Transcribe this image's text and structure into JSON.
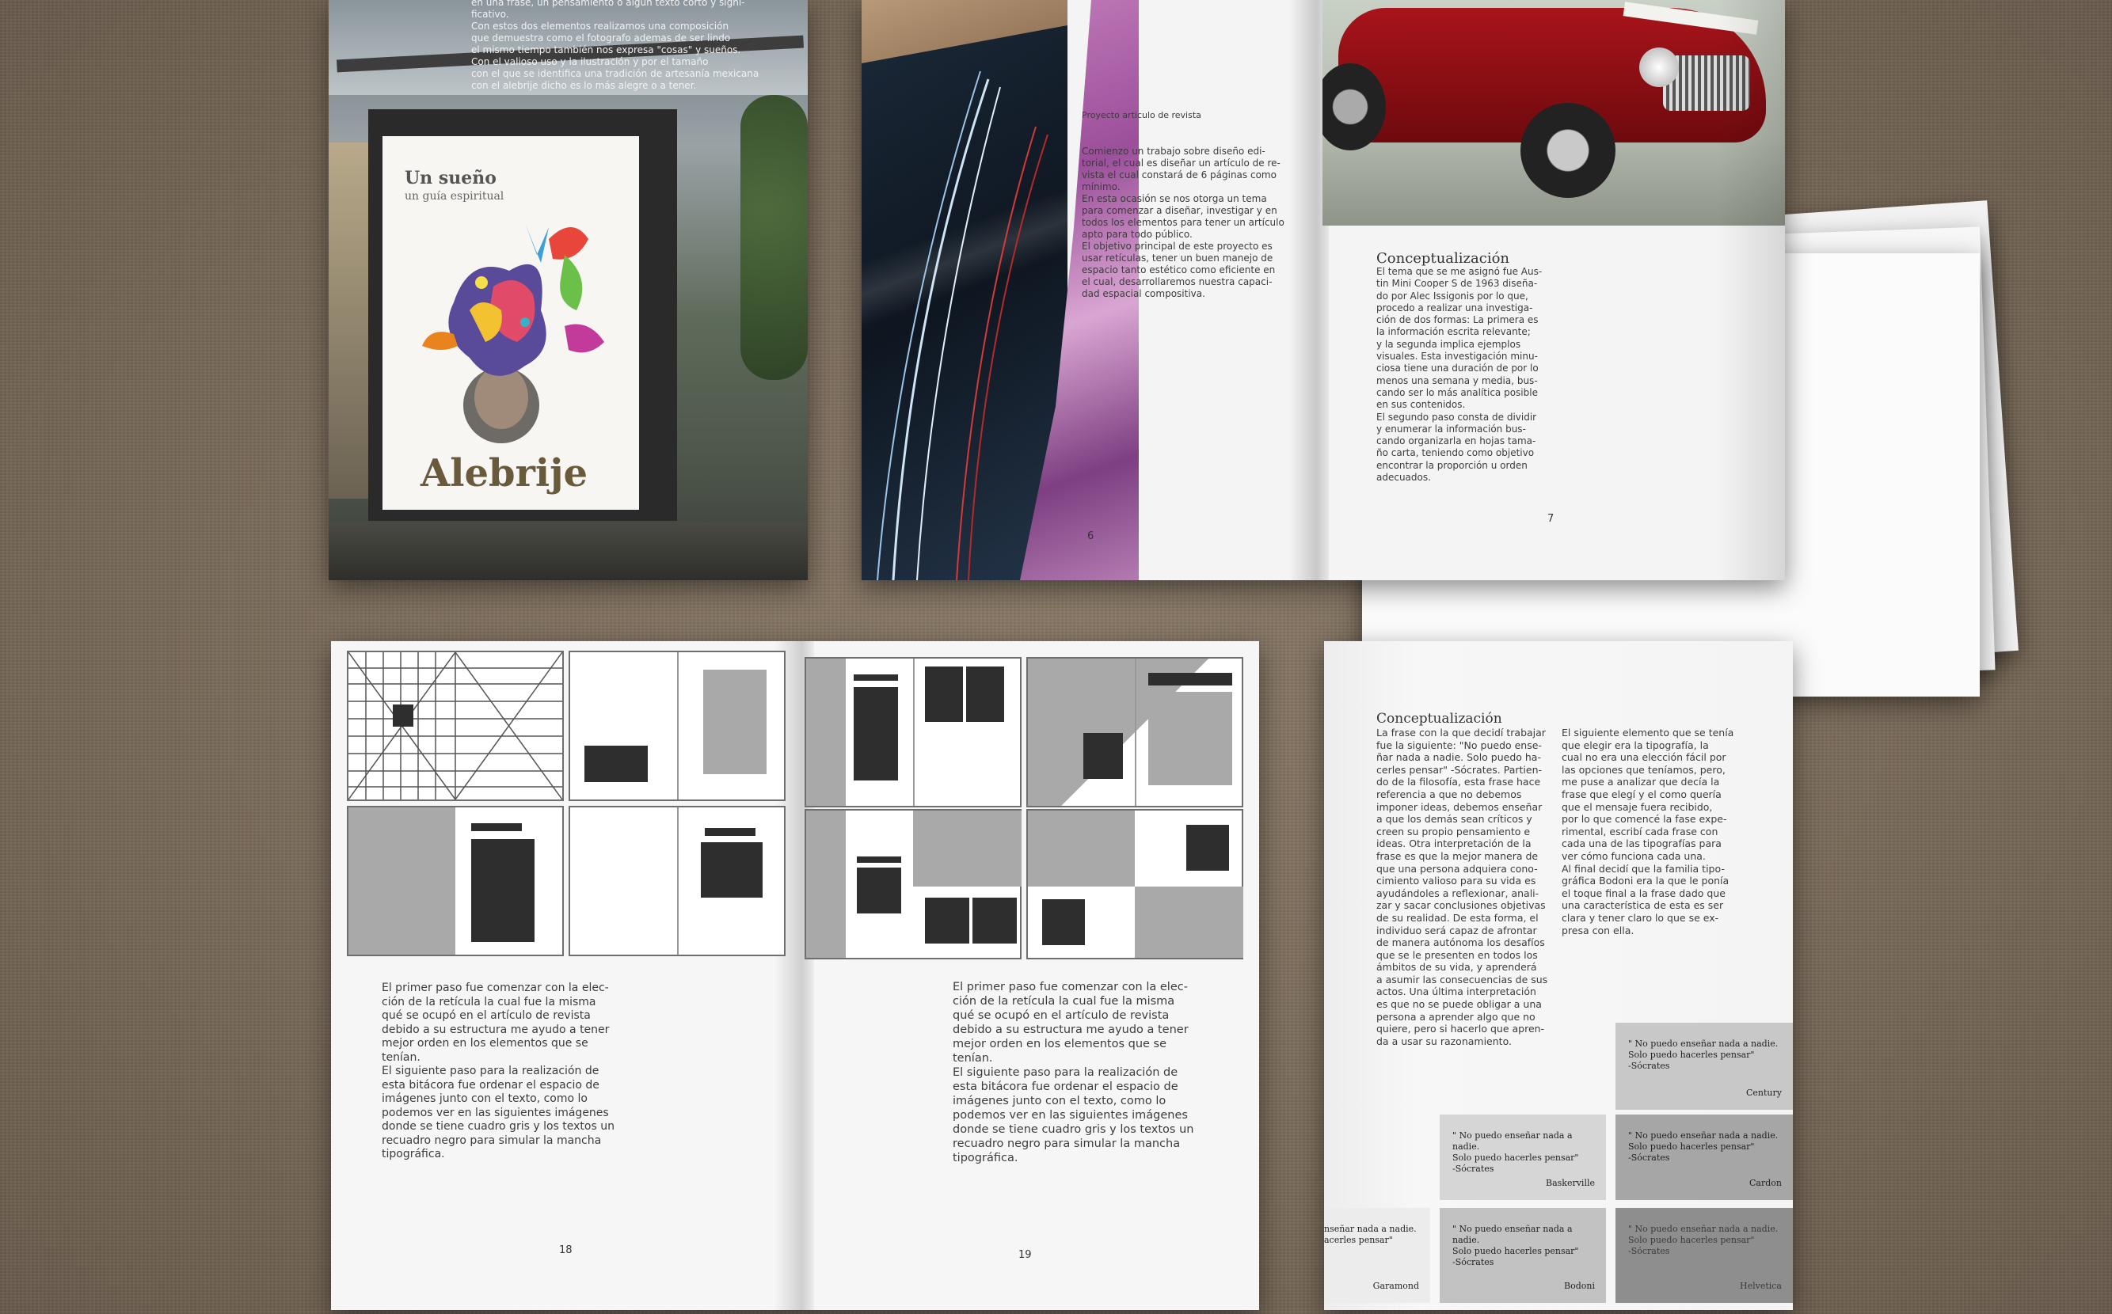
{
  "poster": {
    "title_line1": "Un sueño",
    "title_line2": "un guía espiritual",
    "main_title": "Alebrije",
    "top_text": [
      "en una frase, un pensamiento o algún texto corto y signi-",
      "ficativo.",
      "Con estos dos elementos realizamos una composición",
      "que demuestra como el fotografo ademas de ser lindo",
      "el mismo tiempo también nos expresa \"cosas\" y sueños.",
      "Con el valioso uso y la ilustración y por el tamaño",
      "con el que se identifica una tradición de artesanía mexicana",
      "con el alebrije dicho es lo más alegre o a tener."
    ]
  },
  "spread_top": {
    "left_page_number": "6",
    "right_page_number": "7",
    "project_label": "Proyecto articulo de revista",
    "intro_text": [
      "Comienzo un trabajo sobre diseño edi-",
      "torial, el cual es diseñar un artículo de re-",
      "vista el cual constará de 6 páginas como",
      "mínimo.",
      "En esta ocasión se nos otorga un tema",
      "para comenzar a diseñar, investigar y en",
      "todos los elementos para tener un artículo",
      "apto para todo público.",
      "El objetivo principal de este proyecto es",
      "usar retículas, tener un buen manejo de",
      "espacio tanto estético como eficiente en",
      "el cual, desarrollaremos nuestra capaci-",
      "dad espacial compositiva."
    ],
    "heading": "Conceptualización",
    "body_text": [
      "El tema que se me asignó fue Aus-",
      "tin Mini Cooper S de 1963 diseña-",
      "do por Alec Issigonis por lo que,",
      "procedo a realizar una investiga-",
      "ción de dos formas: La primera es",
      "la información escrita relevante;",
      "y la segunda implica ejemplos",
      "visuales. Esta investigación minu-",
      "ciosa tiene una duración de por lo",
      "menos una semana y media, bus-",
      "cando ser lo más analítica posible",
      "en sus contenidos.",
      "El segundo paso consta de dividir",
      "y enumerar la información bus-",
      "cando organizarla en hojas tama-",
      "ño carta, teniendo como objetivo",
      "encontrar la proporción u orden",
      "adecuados."
    ]
  },
  "spread_bottom": {
    "left_page_number": "18",
    "right_page_number": "19",
    "text": [
      "El primer paso fue comenzar con la elec-",
      "ción de la retícula la cual fue la misma",
      "qué se ocupó en el artículo de revista",
      "debido a su estructura me ayudo a tener",
      "mejor orden en los elementos que se",
      "tenían.",
      "El siguiente paso para la realización de",
      "esta bitácora fue ordenar el espacio de",
      "imágenes junto con el texto, como lo",
      "podemos ver en las siguientes imágenes",
      "donde se tiene cuadro gris y los textos un",
      "recuadro negro para simular la mancha",
      "tipográfica."
    ]
  },
  "single_page": {
    "heading": "Conceptualización",
    "col1": [
      "La frase con la que decidí trabajar",
      "fue la siguiente: \"No puedo ense-",
      "ñar nada a nadie. Solo puedo ha-",
      "cerles pensar\" -Sócrates. Partien-",
      "do de la filosofía, esta frase hace",
      "referencia a que no debemos",
      "imponer ideas, debemos enseñar",
      "a que los demás sean críticos y",
      "creen su propio pensamiento e",
      "ideas. Otra interpretación de la",
      "frase es que la mejor manera de",
      "que una persona adquiera cono-",
      "cimiento valioso para su vida es",
      "ayudándoles a reflexionar, anali-",
      "zar y sacar conclusiones objetivas",
      "de su realidad. De esta forma, el",
      "individuo será capaz de afrontar",
      "de manera autónoma los desafíos",
      "que se le presenten en todos los",
      "ámbitos de su vida, y aprenderá",
      "a asumir las consecuencias de sus",
      "actos. Una última interpretación",
      "es que no se puede obligar a una",
      "persona a aprender algo que no",
      "quiere, pero si hacerlo que apren-",
      "da a usar su razonamiento."
    ],
    "col2": [
      "El siguiente elemento que se tenía",
      "que elegir era la tipografía, la",
      "cual no era una elección fácil por",
      "las opciones que teníamos, pero,",
      "me puse a analizar que decía la",
      "frase que elegí y el como quería",
      "que el mensaje fuera recibido,",
      "por lo que comencé la fase expe-",
      "rimental, escribí cada frase con",
      "cada una de las tipografías para",
      "ver cómo funciona cada una.",
      "Al final decidí que la familia tipo-",
      "gráfica Bodoni era la que le ponía",
      "el toque final a la frase dado que",
      "una característica de esta es ser",
      "clara y tener claro lo que se ex-",
      "presa con ella."
    ],
    "quote_lines": [
      "\" No puedo enseñar nada a nadie.",
      "Solo puedo hacerles pensar\"",
      "-Sócrates"
    ],
    "garamond_lines": [
      "nseñar nada a nadie.",
      "acerles pensar\""
    ],
    "fonts": [
      "Century",
      "Baskerville",
      "Cardon",
      "Garamond",
      "Bodoni",
      "Helvetica"
    ]
  }
}
